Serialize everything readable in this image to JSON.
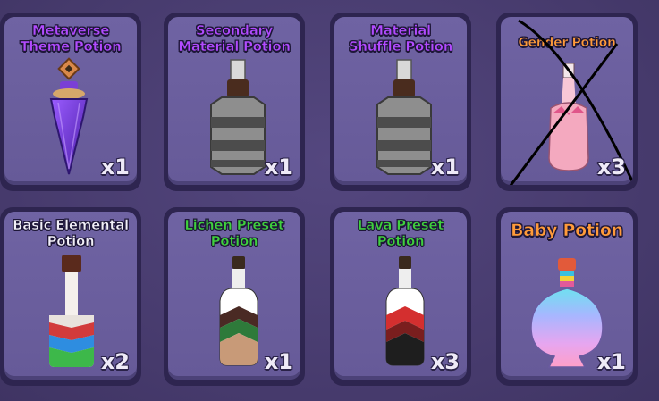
{
  "colors": {
    "purple_title": "#b24bff",
    "green_title": "#3fd13d",
    "orange_title": "#ff9b3a",
    "white_title": "#f2f0f8"
  },
  "items": [
    {
      "title": "Metaverse\nTheme Potion",
      "qty": "x1",
      "title_color": "#b24bff",
      "icon": "metaverse-theme-potion-icon"
    },
    {
      "title": "Secondary\nMaterial Potion",
      "qty": "x1",
      "title_color": "#b24bff",
      "icon": "secondary-material-potion-icon"
    },
    {
      "title": "Material\nShuffle Potion",
      "qty": "x1",
      "title_color": "#b24bff",
      "icon": "material-shuffle-potion-icon"
    },
    {
      "title": "Gender Potion",
      "qty": "x3",
      "title_color": "#ff9b3a",
      "icon": "gender-potion-icon",
      "crossed_out": true
    },
    {
      "title": "Basic Elemental\nPotion",
      "qty": "x2",
      "title_color": "#f2f0f8",
      "icon": "basic-elemental-potion-icon"
    },
    {
      "title": "Lichen Preset\nPotion",
      "qty": "x1",
      "title_color": "#3fd13d",
      "icon": "lichen-preset-potion-icon"
    },
    {
      "title": "Lava Preset\nPotion",
      "qty": "x3",
      "title_color": "#3fd13d",
      "icon": "lava-preset-potion-icon"
    },
    {
      "title": "Baby Potion",
      "qty": "x1",
      "title_color": "#ff9b3a",
      "icon": "baby-potion-icon"
    }
  ]
}
